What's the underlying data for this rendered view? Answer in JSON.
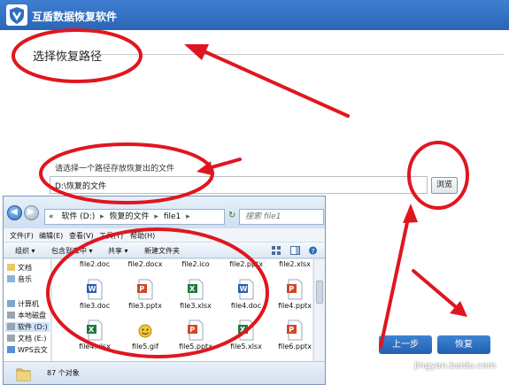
{
  "app": {
    "title": "互盾数据恢复软件",
    "section_title": "选择恢复路径",
    "path_label": "请选择一个路径存放恢复出的文件",
    "path_value": "D:\\恢复的文件",
    "browse_label": "浏览",
    "prev_label": "上一步",
    "next_label": "恢复"
  },
  "explorer": {
    "breadcrumb": [
      "«",
      "软件 (D:)",
      "恢复的文件",
      "file1"
    ],
    "search_placeholder": "搜索 file1",
    "menu": [
      "文件(F)",
      "编辑(E)",
      "查看(V)",
      "工具(T)",
      "帮助(H)"
    ],
    "toolbar": [
      "组织 ▾",
      "包含到库中 ▾",
      "共享 ▾",
      "新建文件夹"
    ],
    "nav_items": [
      "文档",
      "音乐",
      "计算机",
      "本地磁盘",
      "软件 (D:)",
      "文档 (E:)",
      "WPS云文"
    ],
    "top_labels": [
      "file2.doc",
      "file2.docx",
      "file2.ico",
      "file2.pptx",
      "file2.xlsx"
    ],
    "rows": [
      [
        {
          "name": "file3.doc",
          "icon": "word-icon"
        },
        {
          "name": "file3.pptx",
          "icon": "powerpoint-icon"
        },
        {
          "name": "file3.xlsx",
          "icon": "excel-icon"
        },
        {
          "name": "file4.doc",
          "icon": "word-icon"
        },
        {
          "name": "file4.pptx",
          "icon": "powerpoint-icon"
        }
      ],
      [
        {
          "name": "file4.xlsx",
          "icon": "excel-icon"
        },
        {
          "name": "file5.gif",
          "icon": "gif-image-icon"
        },
        {
          "name": "file5.pptx",
          "icon": "powerpoint-icon"
        },
        {
          "name": "file5.xlsx",
          "icon": "excel-icon"
        },
        {
          "name": "file6.pptx",
          "icon": "powerpoint-icon"
        }
      ]
    ],
    "status_count": "87 个对象"
  },
  "watermark": "jingyan.baidu.com",
  "colors": {
    "titlebar": "#2f6fc0",
    "annotation": "#e0161f",
    "word": "#2b5fb3",
    "powerpoint": "#d24726",
    "excel": "#1f7a3e"
  }
}
